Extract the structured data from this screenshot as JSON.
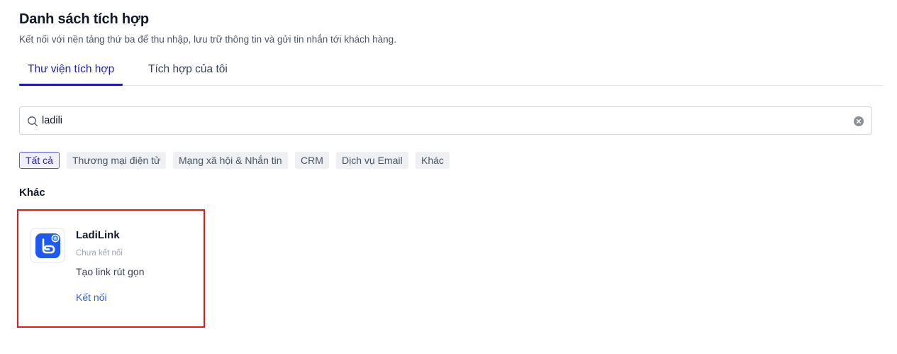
{
  "header": {
    "title": "Danh sách tích hợp",
    "subtitle": "Kết nối với nền tảng thứ ba để thu nhập, lưu trữ thông tin và gửi tin nhắn tới khách hàng."
  },
  "tabs": [
    {
      "label": "Thư viện tích hợp",
      "active": true
    },
    {
      "label": "Tích hợp của tôi",
      "active": false
    }
  ],
  "search": {
    "value": "ladili",
    "icon": "search-icon",
    "clear_icon": "clear-icon"
  },
  "filters": [
    {
      "label": "Tất cả",
      "active": true
    },
    {
      "label": "Thương mại điện tử",
      "active": false
    },
    {
      "label": "Mạng xã hội & Nhắn tin",
      "active": false
    },
    {
      "label": "CRM",
      "active": false
    },
    {
      "label": "Dịch vụ Email",
      "active": false
    },
    {
      "label": "Khác",
      "active": false
    }
  ],
  "section": {
    "title": "Khác"
  },
  "integration": {
    "name": "LadiLink",
    "status": "Chưa kết nối",
    "description": "Tạo link rút gọn",
    "action_label": "Kết nối",
    "logo_icon": "ladilink-logo-icon"
  },
  "colors": {
    "accent": "#1d1da8",
    "link": "#2f5fd6",
    "highlight_border": "#e41a1a",
    "logo_blue": "#1f5af0"
  }
}
